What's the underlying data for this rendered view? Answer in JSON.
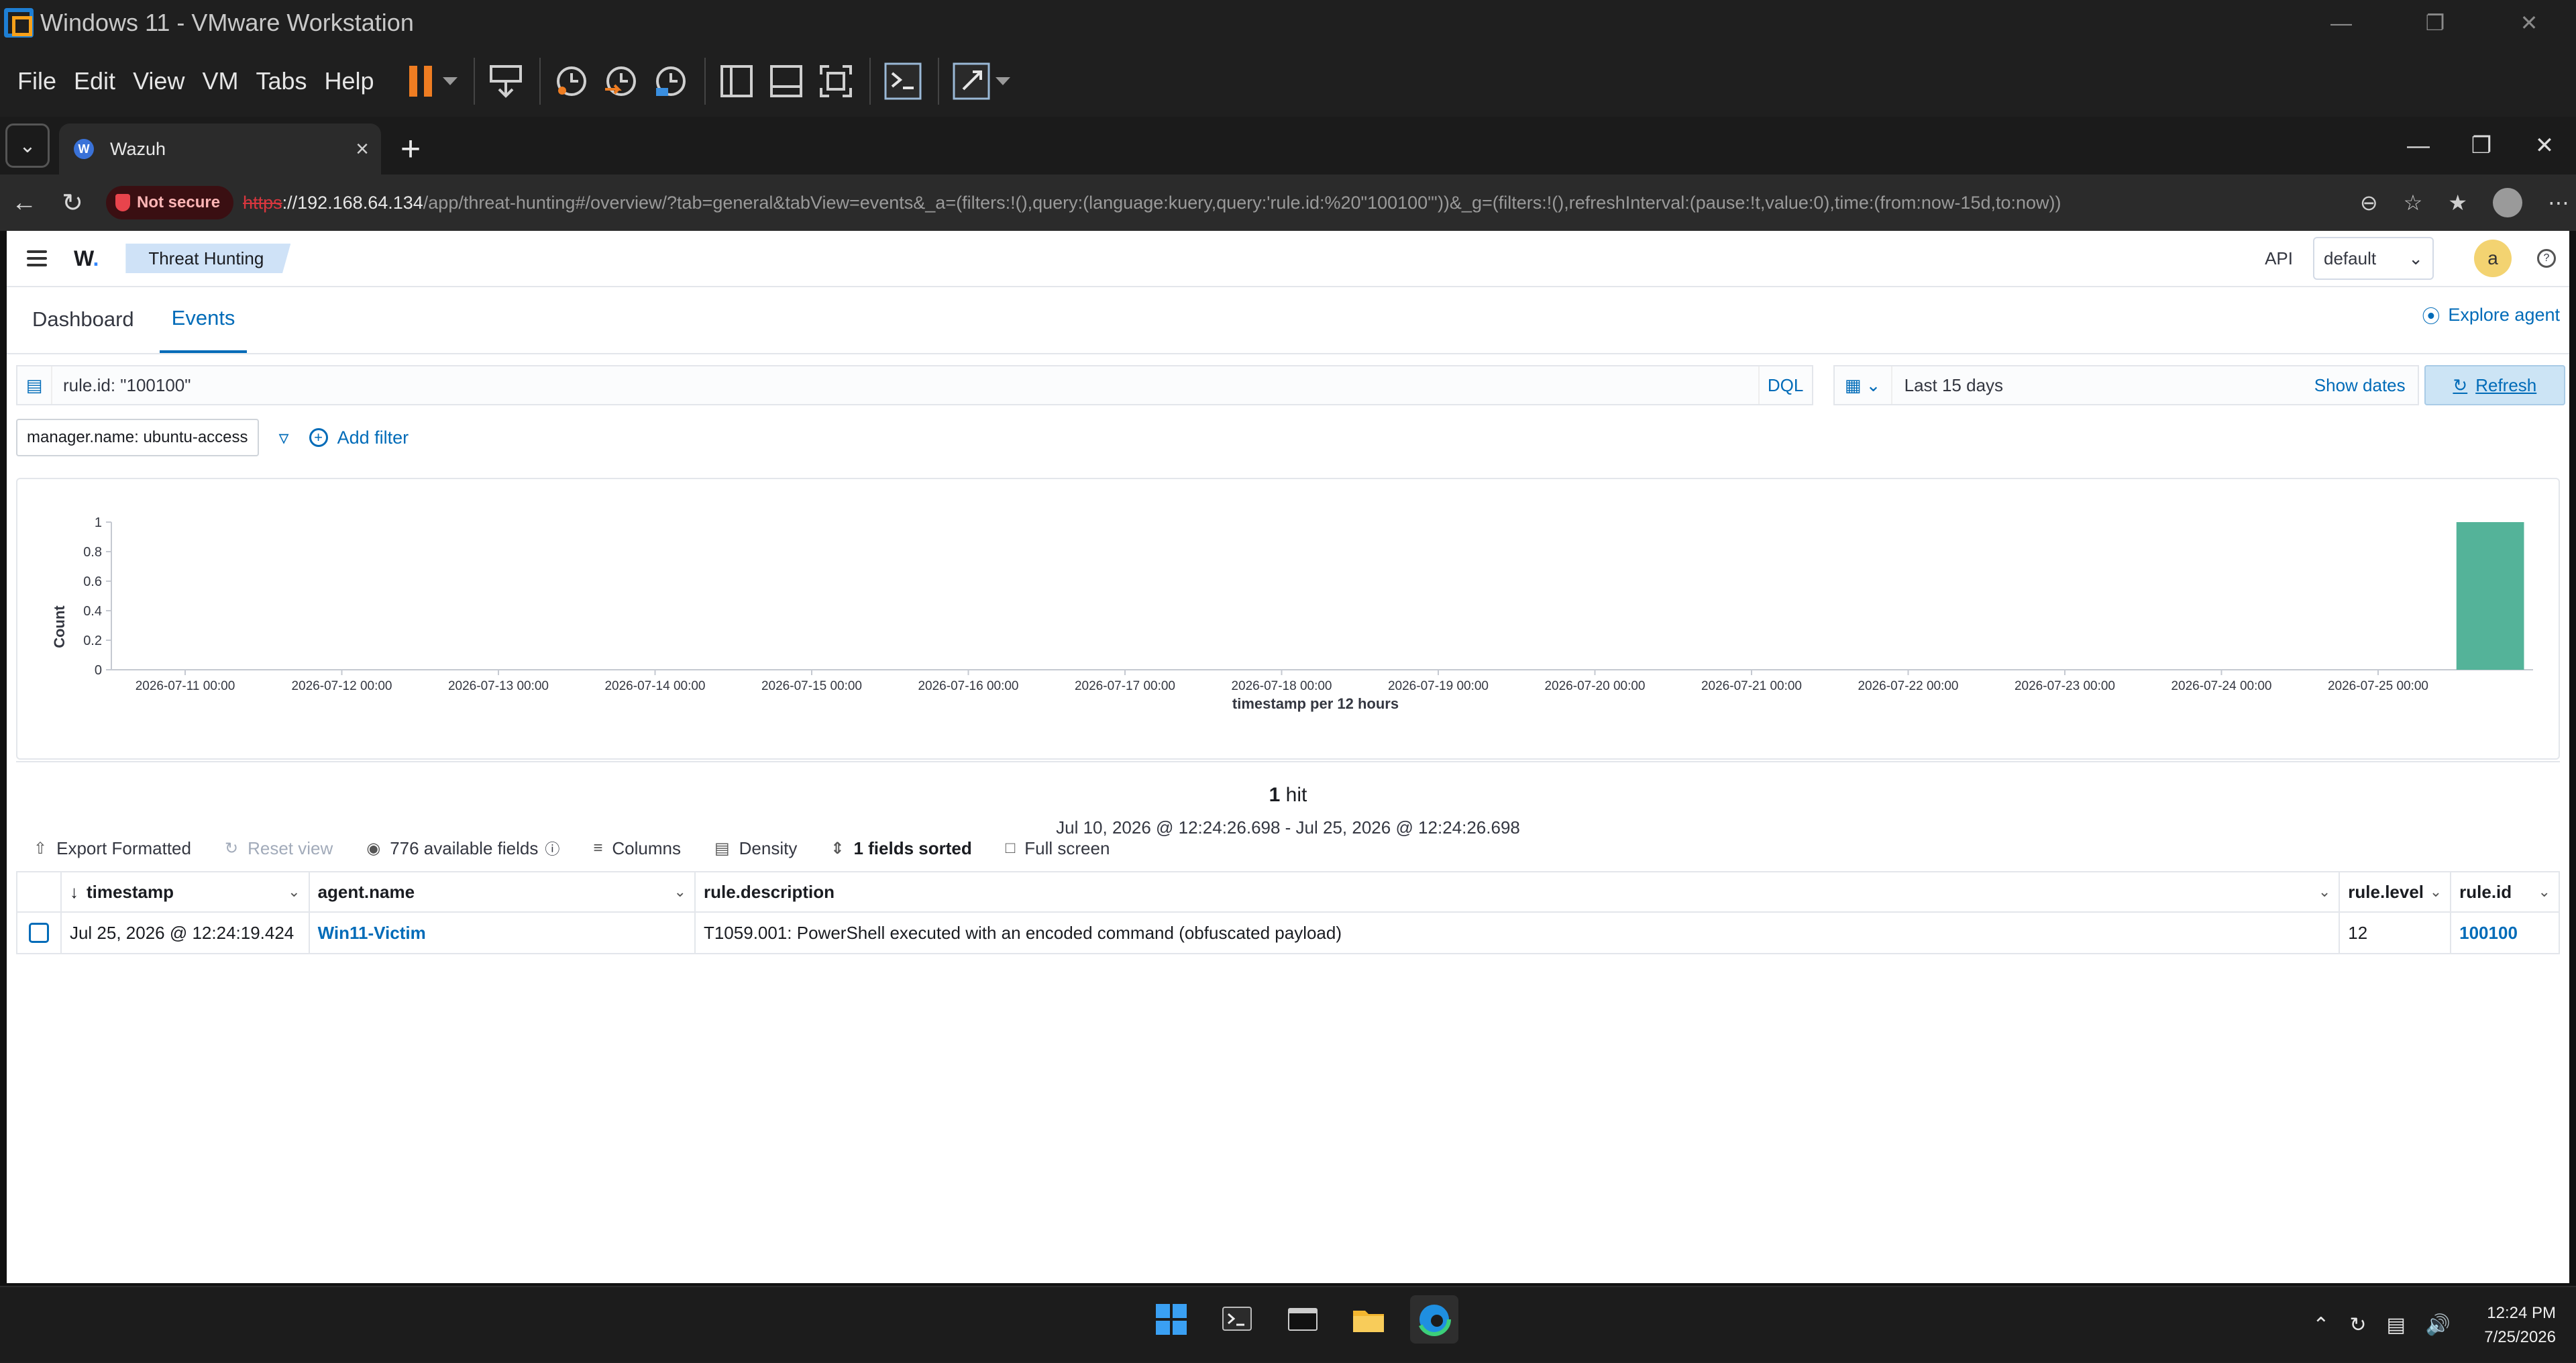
{
  "vmware": {
    "window_title": "Windows 11 - VMware Workstation",
    "menu": [
      "File",
      "Edit",
      "View",
      "VM",
      "Tabs",
      "Help"
    ]
  },
  "browser": {
    "tab_title": "Wazuh",
    "favicon_letter": "W",
    "security_label": "Not secure",
    "url_protocol": "https",
    "url_host": "://192.168.64.134",
    "url_rest": "/app/threat-hunting#/overview/?tab=general&tabView=events&_a=(filters:!(),query:(language:kuery,query:'rule.id:%20\"100100\"'))&_g=(filters:!(),refreshInterval:(pause:!t,value:0),time:(from:now-15d,to:now))"
  },
  "app": {
    "brand_letter": "W",
    "brand_dot": ".",
    "breadcrumb": "Threat Hunting",
    "api_label": "API",
    "api_selected": "default",
    "user_initial": "a",
    "tabs": [
      {
        "label": "Dashboard",
        "active": false
      },
      {
        "label": "Events",
        "active": true
      }
    ],
    "explore_agent": "Explore agent"
  },
  "search": {
    "query": "rule.id: \"100100\"",
    "language": "DQL",
    "date_range": "Last 15 days",
    "show_dates": "Show dates",
    "refresh": "Refresh"
  },
  "filters": {
    "pill": "manager.name: ubuntu-access",
    "add_filter": "Add filter"
  },
  "chart_data": {
    "type": "bar",
    "x_label": "timestamp per 12 hours",
    "y_label": "Count",
    "y_ticks": [
      "1",
      "0.8",
      "0.6",
      "0.4",
      "0.2",
      "0"
    ],
    "ylim": [
      0,
      1
    ],
    "x_ticks": [
      "2026-07-11 00:00",
      "2026-07-12 00:00",
      "2026-07-13 00:00",
      "2026-07-14 00:00",
      "2026-07-15 00:00",
      "2026-07-16 00:00",
      "2026-07-17 00:00",
      "2026-07-18 00:00",
      "2026-07-19 00:00",
      "2026-07-20 00:00",
      "2026-07-21 00:00",
      "2026-07-22 00:00",
      "2026-07-23 00:00",
      "2026-07-24 00:00",
      "2026-07-25 00:00"
    ],
    "bars": [
      {
        "x": "2026-07-25 12:00",
        "value": 1
      }
    ],
    "bar_color": "#54b399"
  },
  "results": {
    "hit_count": "1",
    "hit_word": "hit",
    "time_range": "Jul 10, 2026 @ 12:24:26.698 - Jul 25, 2026 @ 12:24:26.698"
  },
  "grid_toolbar": {
    "export": "Export Formatted",
    "reset": "Reset view",
    "fields": "776 available fields",
    "columns": "Columns",
    "density": "Density",
    "sorted": "1 fields sorted",
    "fullscreen": "Full screen"
  },
  "table": {
    "columns": [
      "timestamp",
      "agent.name",
      "rule.description",
      "rule.level",
      "rule.id"
    ],
    "rows": [
      {
        "timestamp": "Jul 25, 2026 @ 12:24:19.424",
        "agent_name": "Win11-Victim",
        "rule_description": "T1059.001: PowerShell executed with an encoded command (obfuscated payload)",
        "rule_level": "12",
        "rule_id": "100100"
      }
    ]
  },
  "taskbar": {
    "time": "12:24 PM",
    "date": "7/25/2026"
  },
  "colors": {
    "accent": "#006bb8",
    "bar": "#54b399",
    "not_secure": "#d9363e"
  }
}
